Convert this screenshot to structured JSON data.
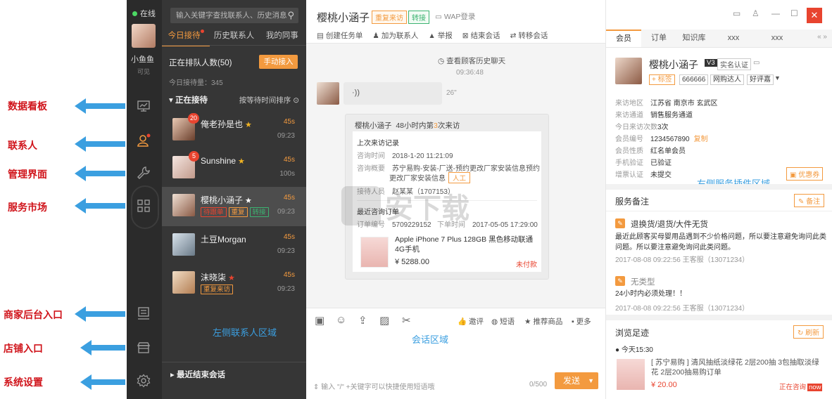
{
  "annotations": {
    "items": [
      "数据看板",
      "联系人",
      "管理界面",
      "服务市场",
      "商家后台入口",
      "店铺入口",
      "系统设置"
    ]
  },
  "rail": {
    "status": "在线",
    "user_name": "小鱼鱼",
    "user_sub": "可见"
  },
  "contacts": {
    "search_placeholder": "输入关键字查找联系人、历史消息",
    "tabs": [
      "今日接待",
      "历史联系人",
      "我的同事"
    ],
    "queue_label": "正在排队人数(50)",
    "queue_button": "手动接入",
    "today_wait": "今日接待量：345",
    "section": "正在接待",
    "sort": "按等待时间排序",
    "list": [
      {
        "name": "俺老孙是也",
        "badge": "20",
        "time": "45s",
        "clock": "09:23",
        "star": "★",
        "star_color": "#f0b323",
        "tags": []
      },
      {
        "name": "Sunshine",
        "badge": "5",
        "time": "45s",
        "clock": "100s",
        "star": "★",
        "star_color": "#f0b323",
        "tags": []
      },
      {
        "name": "樱桃小涵子",
        "badge": "",
        "time": "45s",
        "clock": "09:23",
        "star": "★",
        "star_color": "#ffffff",
        "tags": [
          "待跟单",
          "重复",
          "转接"
        ]
      },
      {
        "name": "土豆Morgan",
        "badge": "",
        "time": "45s",
        "clock": "09:23",
        "star": "",
        "star_color": "",
        "tags": []
      },
      {
        "name": "沫晓柒",
        "badge": "",
        "time": "45s",
        "clock": "09:23",
        "star": "★",
        "star_color": "#e8442f",
        "tags": [
          "重复来访"
        ]
      }
    ],
    "area_label": "左侧联系人区域",
    "recent": "最近结束会话"
  },
  "chat": {
    "title": "樱桃小涵子",
    "tag_repeat": "重复来访",
    "tag_transfer": "转接",
    "wap": "WAP登录",
    "toolbar": [
      "创建任务单",
      "加为联系人",
      "举报",
      "结束会话",
      "转移会话"
    ],
    "history": "查看顾客历史聊天",
    "history_time": "09:36:48",
    "voice_icon": "·))",
    "voice_length": "26\"",
    "card": {
      "head_name": "樱桃小涵子",
      "head_pre": "48小时内第",
      "head_num": "3",
      "head_post": "次来访",
      "last_visit": "上次来访记录",
      "consult_time_k": "咨询时间",
      "consult_time_v": "2018-1-20 11:21:09",
      "consult_sum_k": "咨询概要",
      "consult_sum_v1": "苏宁易购-安装-厂送-预约更改厂家安装信息预约",
      "consult_sum_v2": "更改厂家安装信息",
      "rengong": "人工",
      "staff_k": "接待人员",
      "staff_v": "赵某某（1707153）",
      "order_title": "最近咨询订单",
      "order_k": "订单编号",
      "order_v": "5709229152",
      "order_time_k": "下单时间",
      "order_time_v": "2017-05-05 17:29:00",
      "product": "Apple iPhone 7 Plus 128GB 黑色移动联通4G手机",
      "price": "¥ 5288.00",
      "status": "未付款"
    },
    "tools_right": [
      "邀评",
      "短语",
      "推荐商品",
      "更多"
    ],
    "area_label": "会话区域",
    "input_hint": "输入 \"/\" +关键字可以快捷使用短语哦",
    "count": "0/500",
    "send": "发送"
  },
  "right": {
    "tabs": [
      "会员",
      "订单",
      "知识库",
      "xxx",
      "xxx"
    ],
    "more": "«  »",
    "member": {
      "name": "樱桃小涵子",
      "level": "V3",
      "verify": "实名认证",
      "add_tag": "+ 标签",
      "tags": [
        "666666",
        "网购达人",
        "好评嘉"
      ],
      "rows": [
        {
          "k": "来访地区",
          "v": "江苏省  南京市  玄武区"
        },
        {
          "k": "来访通道",
          "v": "销售服务通道"
        },
        {
          "k": "今日来访次数",
          "v": "3次"
        },
        {
          "k": "会员编号",
          "v": "1234567890"
        },
        {
          "k": "会员性质",
          "v": "红名单会员"
        },
        {
          "k": "手机验证",
          "v": "已验证"
        },
        {
          "k": "增票认证",
          "v": "未提交"
        }
      ],
      "copy": "复制",
      "coupon": "优惠券"
    },
    "area_label": "右侧服务插件区域",
    "notes": {
      "title": "服务备注",
      "button": "备注",
      "items": [
        {
          "title": "退换货/退货/大件无货",
          "body": "最近此顾客买母婴用品遇到不少价格问题，所以要注意避免询问此类问题。所以要注意避免询问此类问题。",
          "meta": "2017-08-08 09:22:56 王客服（13071234）"
        },
        {
          "title": "无类型",
          "body": "24小时内必须处理！！",
          "meta": "2017-08-08 09:22:56 王客服（13071234）"
        }
      ]
    },
    "footprint": {
      "title": "浏览足迹",
      "button": "刷新",
      "day": "今天15:30",
      "product": "[ 苏宁易购 ] 清风抽纸淡绿花 2层200抽 3包抽取淡绿花 2层200抽易购订单",
      "price": "¥ 20.00",
      "status": "正在咨询",
      "status_badge": "now"
    }
  },
  "watermark": "安下载"
}
